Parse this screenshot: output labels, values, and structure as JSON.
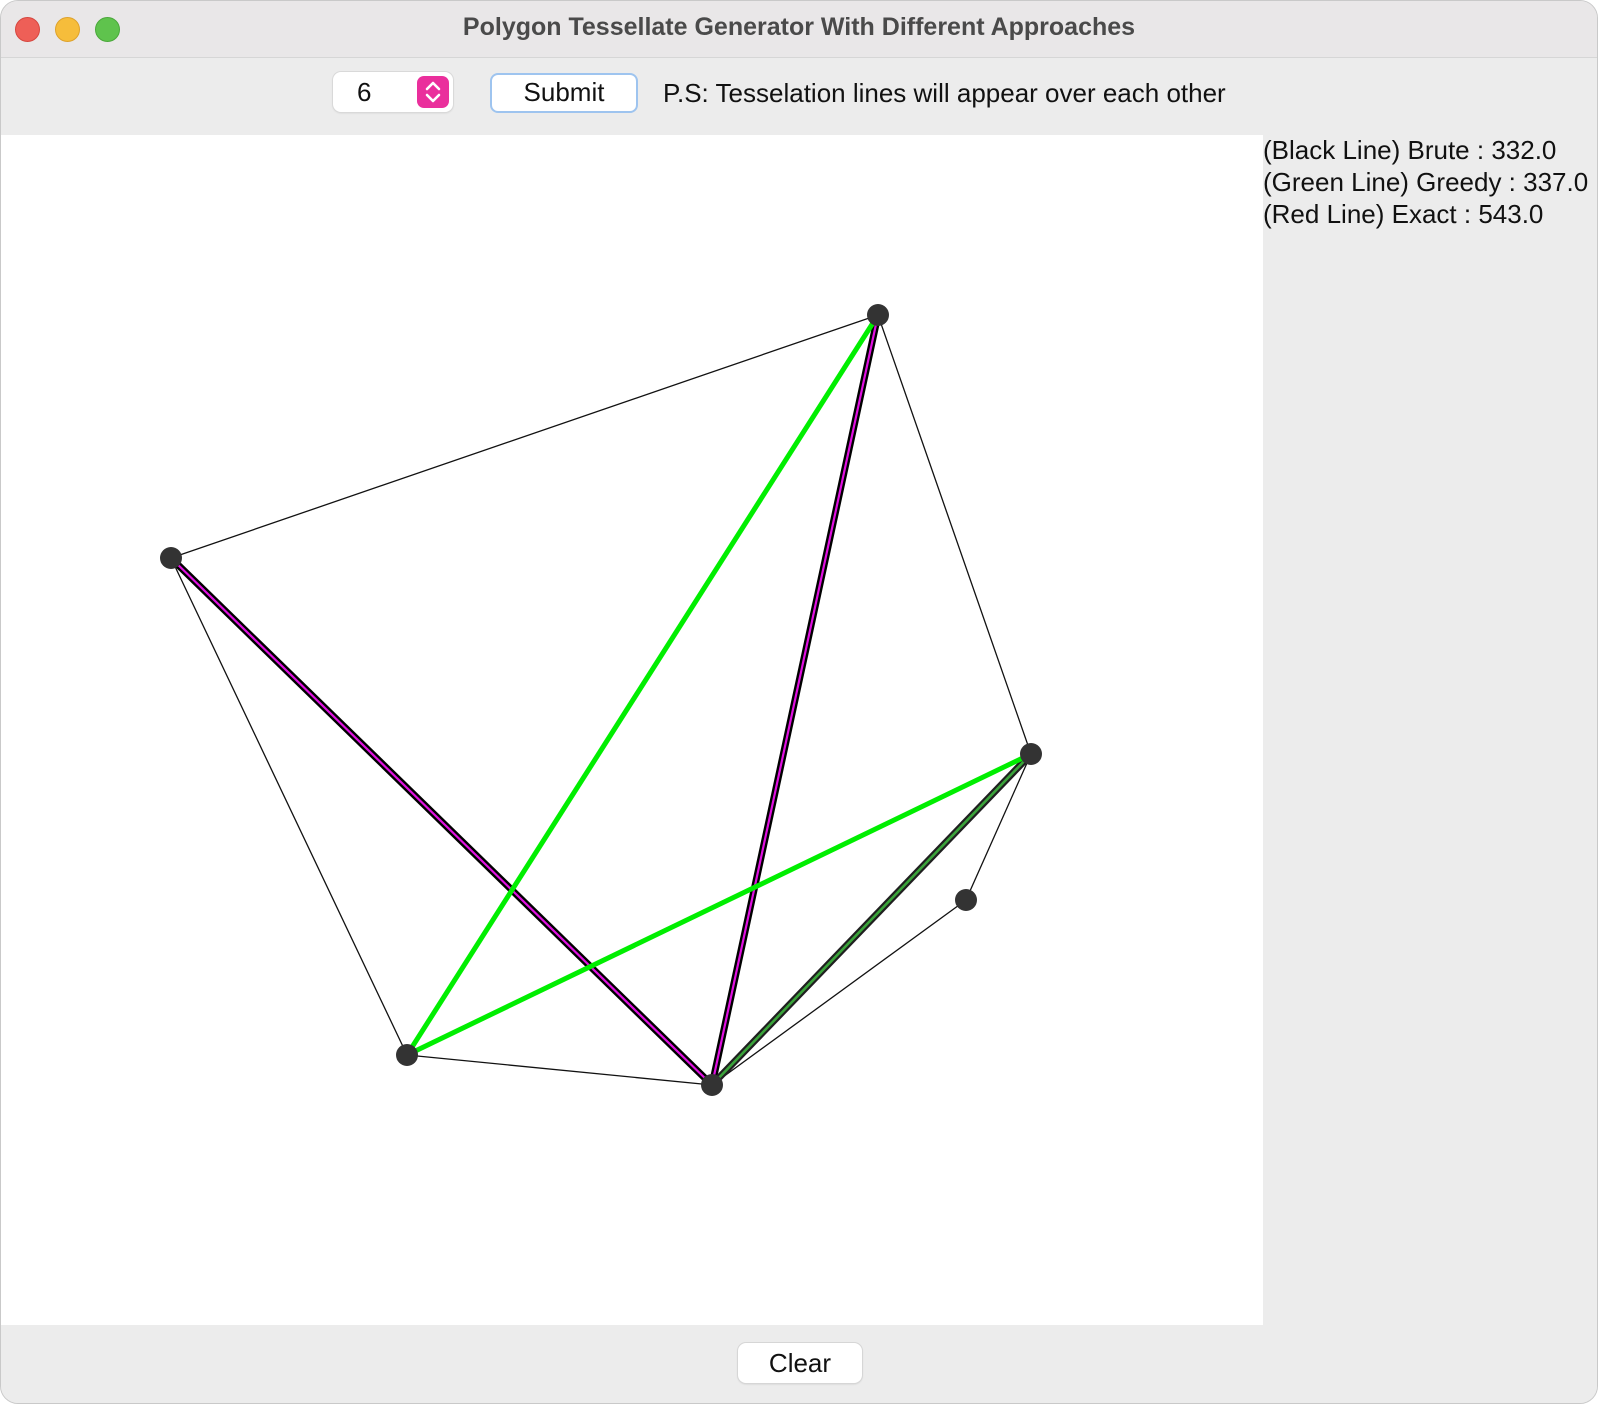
{
  "window": {
    "title": "Polygon Tessellate Generator With Different Approaches"
  },
  "toolbar": {
    "vertex_count": "6",
    "submit_label": "Submit",
    "note": "P.S: Tesselation lines will appear over each other"
  },
  "results": {
    "brute": "(Black Line) Brute : 332.0",
    "greedy": "(Green Line) Greedy : 337.0",
    "exact": "(Red Line) Exact : 543.0"
  },
  "footer": {
    "clear_label": "Clear"
  },
  "colors": {
    "outline": "#111111",
    "brute": "#000000",
    "greedy": "#00ee00",
    "exact": "#e010e0",
    "vertex": "#333333",
    "spinner_accent": "#ea2f9c"
  }
}
